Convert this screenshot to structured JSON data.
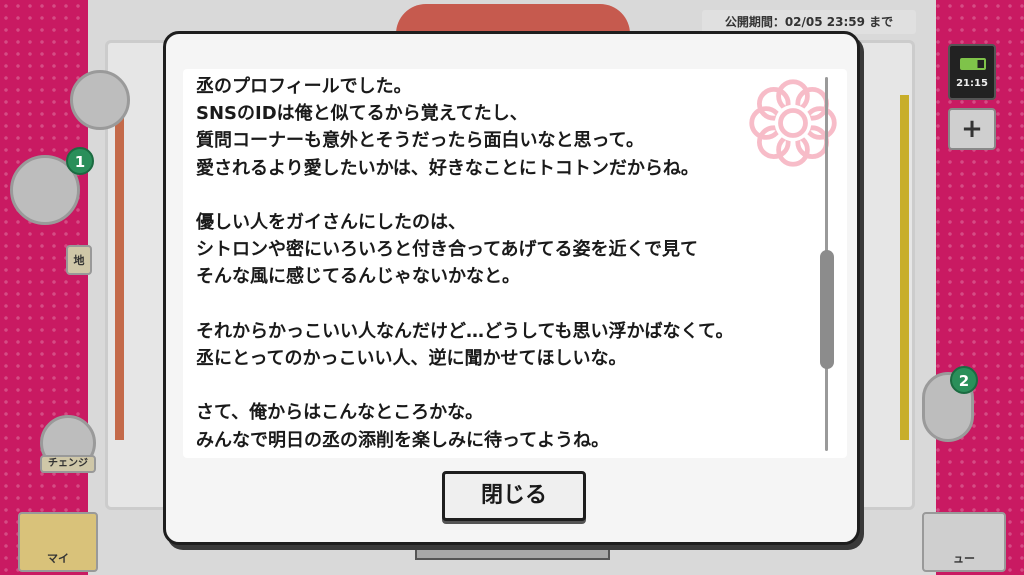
{
  "background": {
    "deadline_label": "公開期間：02/05 23:59 まで",
    "clock_time": "21:15",
    "plus_label": "+",
    "badge_left": "1",
    "badge_right": "2",
    "tile_change_label": "チェンジ",
    "tile_myhome_label": "マイ",
    "tile_menu_label": "ュー",
    "tile_map_label": "地"
  },
  "dialog": {
    "lines": [
      "丞のプロフィールでした。",
      "SNSのIDは俺と似てるから覚えてたし、",
      "質問コーナーも意外とそうだったら面白いなと思って。",
      "愛されるより愛したいかは、好きなことにトコトンだからね。",
      "",
      "優しい人をガイさんにしたのは、",
      "シトロンや密にいろいろと付き合ってあげてる姿を近くで見て",
      "そんな風に感じてるんじゃないかなと。",
      "",
      "それからかっこいい人なんだけど…どうしても思い浮かばなくて。",
      "丞にとってのかっこいい人、逆に聞かせてほしいな。",
      "",
      "さて、俺からはこんなところかな。",
      "みんなで明日の丞の添削を楽しみに待ってようね。"
    ],
    "scroll_position": 0.68,
    "close_label": "閉じる"
  },
  "colors": {
    "accent_pink": "#d81e6a",
    "flower_pink": "#f7b9c6"
  }
}
